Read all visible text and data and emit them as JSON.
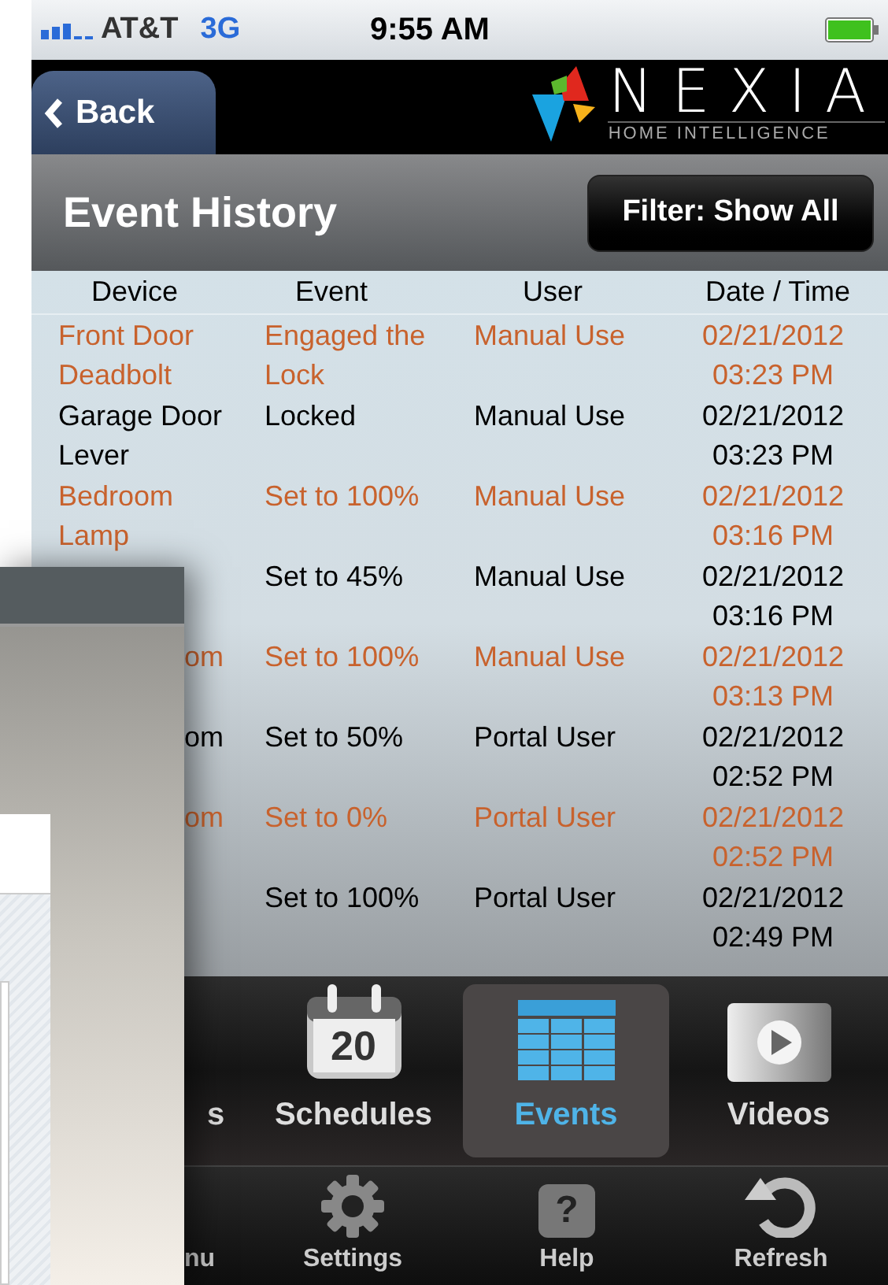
{
  "status_bar": {
    "carrier": "AT&T",
    "network": "3G",
    "time": "9:55 AM"
  },
  "nav_bar": {
    "back": "Back",
    "logo": {
      "name": "NEXIA",
      "tagline": "HOME INTELLIGENCE"
    }
  },
  "header": {
    "title": "Event History",
    "filter_button": "Filter: Show All"
  },
  "table": {
    "columns": [
      "Device",
      "Event",
      "User",
      "Date / Time"
    ],
    "rows": [
      {
        "highlighted": true,
        "covered": false,
        "device": "Front Door Deadbolt",
        "event": "Engaged the Lock",
        "user": "Manual Use",
        "date": "02/21/2012",
        "time": "03:23 PM"
      },
      {
        "highlighted": false,
        "covered": false,
        "device": "Garage Door Lever",
        "event": "Locked",
        "user": "Manual Use",
        "date": "02/21/2012",
        "time": "03:23 PM"
      },
      {
        "highlighted": true,
        "covered": false,
        "device": "Bedroom Lamp",
        "event": "Set to 100%",
        "user": "Manual Use",
        "date": "02/21/2012",
        "time": "03:16 PM"
      },
      {
        "highlighted": false,
        "event": "Set to 45%",
        "user": "Manual Use",
        "date": "02/21/2012",
        "time": "03:16 PM"
      },
      {
        "highlighted": true,
        "covered": true,
        "device": "om",
        "event": "Set to 100%",
        "user": "Manual Use",
        "date": "02/21/2012",
        "time": "03:13 PM"
      },
      {
        "highlighted": false,
        "covered": true,
        "device": "om",
        "event": "Set to 50%",
        "user": "Portal User",
        "date": "02/21/2012",
        "time": "02:52 PM"
      },
      {
        "highlighted": true,
        "covered": true,
        "device": "om",
        "event": "Set to 0%",
        "user": "Portal User",
        "date": "02/21/2012",
        "time": "02:52 PM"
      },
      {
        "highlighted": false,
        "event": "Set to 100%",
        "user": "Portal User",
        "date": "02/21/2012",
        "time": "02:49 PM"
      }
    ]
  },
  "tab_bar": [
    {
      "kind": "covered",
      "label": "s",
      "selected": false
    },
    {
      "kind": "schedules",
      "label": "Schedules",
      "icon_text": "20",
      "selected": false
    },
    {
      "kind": "events",
      "label": "Events",
      "selected": true
    },
    {
      "kind": "videos",
      "label": "Videos",
      "selected": false
    }
  ],
  "toolbar": [
    {
      "kind": "covered",
      "label": "nu"
    },
    {
      "kind": "settings",
      "label": "Settings"
    },
    {
      "kind": "help",
      "label": "Help",
      "icon_text": "?"
    },
    {
      "kind": "refresh",
      "label": "Refresh"
    }
  ],
  "overlay_window": {
    "kind": "window"
  }
}
